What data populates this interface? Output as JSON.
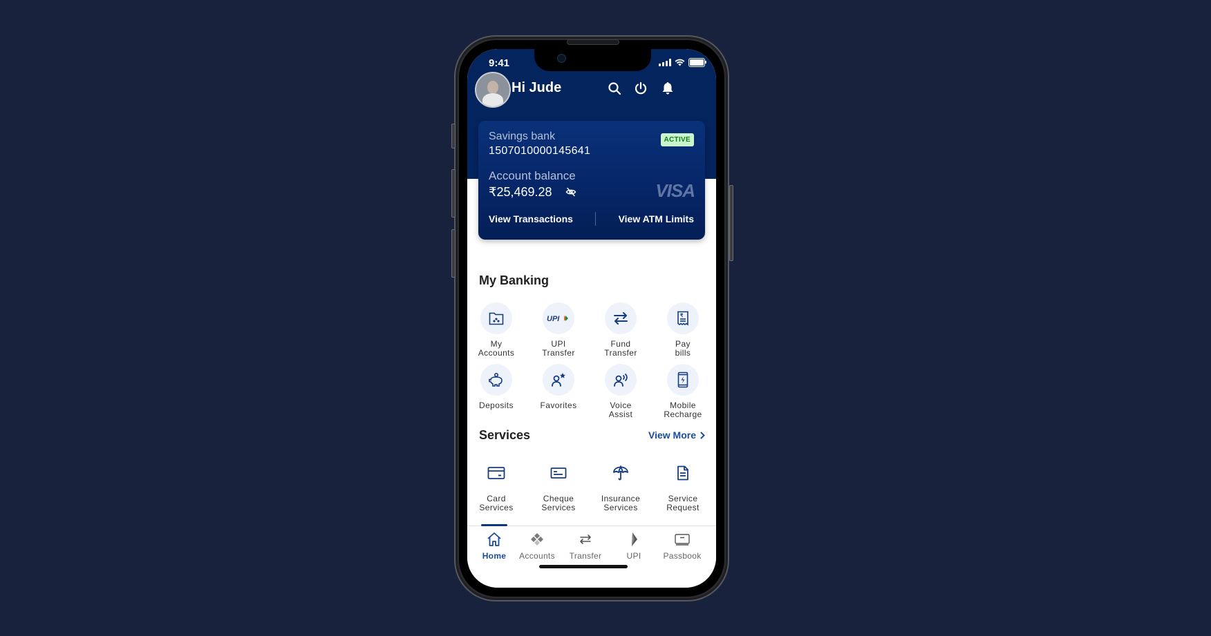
{
  "status_bar": {
    "time": "9:41"
  },
  "header": {
    "greeting": "Hi Jude",
    "icons": [
      "search-icon",
      "power-icon",
      "bell-icon"
    ]
  },
  "account_card": {
    "account_type": "Savings bank",
    "account_number": "1507010000145641",
    "status_badge": "ACTIVE",
    "balance_label": "Account balance",
    "balance_value": "₹25,469.28",
    "card_brand": "VISA",
    "links": {
      "view_transactions": "View Transactions",
      "view_atm_limits": "View ATM Limits"
    }
  },
  "my_banking": {
    "title": "My Banking",
    "items": [
      {
        "label": "My\nAccounts",
        "icon": "folder-accounts-icon"
      },
      {
        "label": "UPI\nTransfer",
        "icon": "upi-icon"
      },
      {
        "label": "Fund\nTransfer",
        "icon": "transfer-arrows-icon"
      },
      {
        "label": "Pay\nbills",
        "icon": "bill-receipt-icon"
      },
      {
        "label": "Deposits",
        "icon": "piggy-bank-icon"
      },
      {
        "label": "Favorites",
        "icon": "person-star-icon"
      },
      {
        "label": "Voice\nAssist",
        "icon": "voice-person-icon"
      },
      {
        "label": "Mobile\nRecharge",
        "icon": "mobile-charge-icon"
      }
    ]
  },
  "services": {
    "title": "Services",
    "view_more": "View More",
    "items": [
      {
        "label": "Card\nServices",
        "icon": "card-icon"
      },
      {
        "label": "Cheque\nServices",
        "icon": "cheque-icon"
      },
      {
        "label": "Insurance\nServices",
        "icon": "umbrella-icon"
      },
      {
        "label": "Service\nRequest",
        "icon": "document-icon"
      }
    ]
  },
  "tab_bar": {
    "active": "Home",
    "tabs": [
      {
        "label": "Home",
        "icon": "home-icon"
      },
      {
        "label": "Accounts",
        "icon": "accounts-logo-icon"
      },
      {
        "label": "Transfer",
        "icon": "transfer-icon"
      },
      {
        "label": "UPI",
        "icon": "upi-logo-icon"
      },
      {
        "label": "Passbook",
        "icon": "passbook-icon"
      }
    ]
  },
  "colors": {
    "primary_navy": "#04245e",
    "accent_blue": "#1a4b9a",
    "active_badge_bg": "#c9f6cc",
    "active_badge_text": "#137a1d",
    "page_background": "#18223d"
  }
}
